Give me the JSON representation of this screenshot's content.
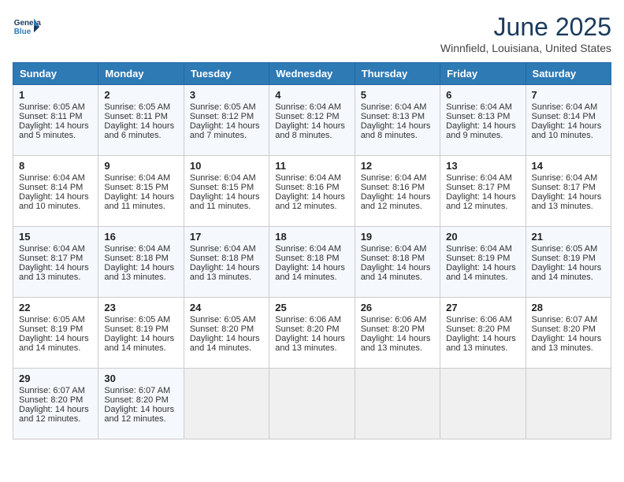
{
  "header": {
    "logo_line1": "General",
    "logo_line2": "Blue",
    "month_title": "June 2025",
    "subtitle": "Winnfield, Louisiana, United States"
  },
  "days_of_week": [
    "Sunday",
    "Monday",
    "Tuesday",
    "Wednesday",
    "Thursday",
    "Friday",
    "Saturday"
  ],
  "weeks": [
    [
      {
        "day": 1,
        "lines": [
          "Sunrise: 6:05 AM",
          "Sunset: 8:11 PM",
          "Daylight: 14 hours",
          "and 5 minutes."
        ]
      },
      {
        "day": 2,
        "lines": [
          "Sunrise: 6:05 AM",
          "Sunset: 8:11 PM",
          "Daylight: 14 hours",
          "and 6 minutes."
        ]
      },
      {
        "day": 3,
        "lines": [
          "Sunrise: 6:05 AM",
          "Sunset: 8:12 PM",
          "Daylight: 14 hours",
          "and 7 minutes."
        ]
      },
      {
        "day": 4,
        "lines": [
          "Sunrise: 6:04 AM",
          "Sunset: 8:12 PM",
          "Daylight: 14 hours",
          "and 8 minutes."
        ]
      },
      {
        "day": 5,
        "lines": [
          "Sunrise: 6:04 AM",
          "Sunset: 8:13 PM",
          "Daylight: 14 hours",
          "and 8 minutes."
        ]
      },
      {
        "day": 6,
        "lines": [
          "Sunrise: 6:04 AM",
          "Sunset: 8:13 PM",
          "Daylight: 14 hours",
          "and 9 minutes."
        ]
      },
      {
        "day": 7,
        "lines": [
          "Sunrise: 6:04 AM",
          "Sunset: 8:14 PM",
          "Daylight: 14 hours",
          "and 10 minutes."
        ]
      }
    ],
    [
      {
        "day": 8,
        "lines": [
          "Sunrise: 6:04 AM",
          "Sunset: 8:14 PM",
          "Daylight: 14 hours",
          "and 10 minutes."
        ]
      },
      {
        "day": 9,
        "lines": [
          "Sunrise: 6:04 AM",
          "Sunset: 8:15 PM",
          "Daylight: 14 hours",
          "and 11 minutes."
        ]
      },
      {
        "day": 10,
        "lines": [
          "Sunrise: 6:04 AM",
          "Sunset: 8:15 PM",
          "Daylight: 14 hours",
          "and 11 minutes."
        ]
      },
      {
        "day": 11,
        "lines": [
          "Sunrise: 6:04 AM",
          "Sunset: 8:16 PM",
          "Daylight: 14 hours",
          "and 12 minutes."
        ]
      },
      {
        "day": 12,
        "lines": [
          "Sunrise: 6:04 AM",
          "Sunset: 8:16 PM",
          "Daylight: 14 hours",
          "and 12 minutes."
        ]
      },
      {
        "day": 13,
        "lines": [
          "Sunrise: 6:04 AM",
          "Sunset: 8:17 PM",
          "Daylight: 14 hours",
          "and 12 minutes."
        ]
      },
      {
        "day": 14,
        "lines": [
          "Sunrise: 6:04 AM",
          "Sunset: 8:17 PM",
          "Daylight: 14 hours",
          "and 13 minutes."
        ]
      }
    ],
    [
      {
        "day": 15,
        "lines": [
          "Sunrise: 6:04 AM",
          "Sunset: 8:17 PM",
          "Daylight: 14 hours",
          "and 13 minutes."
        ]
      },
      {
        "day": 16,
        "lines": [
          "Sunrise: 6:04 AM",
          "Sunset: 8:18 PM",
          "Daylight: 14 hours",
          "and 13 minutes."
        ]
      },
      {
        "day": 17,
        "lines": [
          "Sunrise: 6:04 AM",
          "Sunset: 8:18 PM",
          "Daylight: 14 hours",
          "and 13 minutes."
        ]
      },
      {
        "day": 18,
        "lines": [
          "Sunrise: 6:04 AM",
          "Sunset: 8:18 PM",
          "Daylight: 14 hours",
          "and 14 minutes."
        ]
      },
      {
        "day": 19,
        "lines": [
          "Sunrise: 6:04 AM",
          "Sunset: 8:18 PM",
          "Daylight: 14 hours",
          "and 14 minutes."
        ]
      },
      {
        "day": 20,
        "lines": [
          "Sunrise: 6:04 AM",
          "Sunset: 8:19 PM",
          "Daylight: 14 hours",
          "and 14 minutes."
        ]
      },
      {
        "day": 21,
        "lines": [
          "Sunrise: 6:05 AM",
          "Sunset: 8:19 PM",
          "Daylight: 14 hours",
          "and 14 minutes."
        ]
      }
    ],
    [
      {
        "day": 22,
        "lines": [
          "Sunrise: 6:05 AM",
          "Sunset: 8:19 PM",
          "Daylight: 14 hours",
          "and 14 minutes."
        ]
      },
      {
        "day": 23,
        "lines": [
          "Sunrise: 6:05 AM",
          "Sunset: 8:19 PM",
          "Daylight: 14 hours",
          "and 14 minutes."
        ]
      },
      {
        "day": 24,
        "lines": [
          "Sunrise: 6:05 AM",
          "Sunset: 8:20 PM",
          "Daylight: 14 hours",
          "and 14 minutes."
        ]
      },
      {
        "day": 25,
        "lines": [
          "Sunrise: 6:06 AM",
          "Sunset: 8:20 PM",
          "Daylight: 14 hours",
          "and 13 minutes."
        ]
      },
      {
        "day": 26,
        "lines": [
          "Sunrise: 6:06 AM",
          "Sunset: 8:20 PM",
          "Daylight: 14 hours",
          "and 13 minutes."
        ]
      },
      {
        "day": 27,
        "lines": [
          "Sunrise: 6:06 AM",
          "Sunset: 8:20 PM",
          "Daylight: 14 hours",
          "and 13 minutes."
        ]
      },
      {
        "day": 28,
        "lines": [
          "Sunrise: 6:07 AM",
          "Sunset: 8:20 PM",
          "Daylight: 14 hours",
          "and 13 minutes."
        ]
      }
    ],
    [
      {
        "day": 29,
        "lines": [
          "Sunrise: 6:07 AM",
          "Sunset: 8:20 PM",
          "Daylight: 14 hours",
          "and 12 minutes."
        ]
      },
      {
        "day": 30,
        "lines": [
          "Sunrise: 6:07 AM",
          "Sunset: 8:20 PM",
          "Daylight: 14 hours",
          "and 12 minutes."
        ]
      },
      null,
      null,
      null,
      null,
      null
    ]
  ]
}
